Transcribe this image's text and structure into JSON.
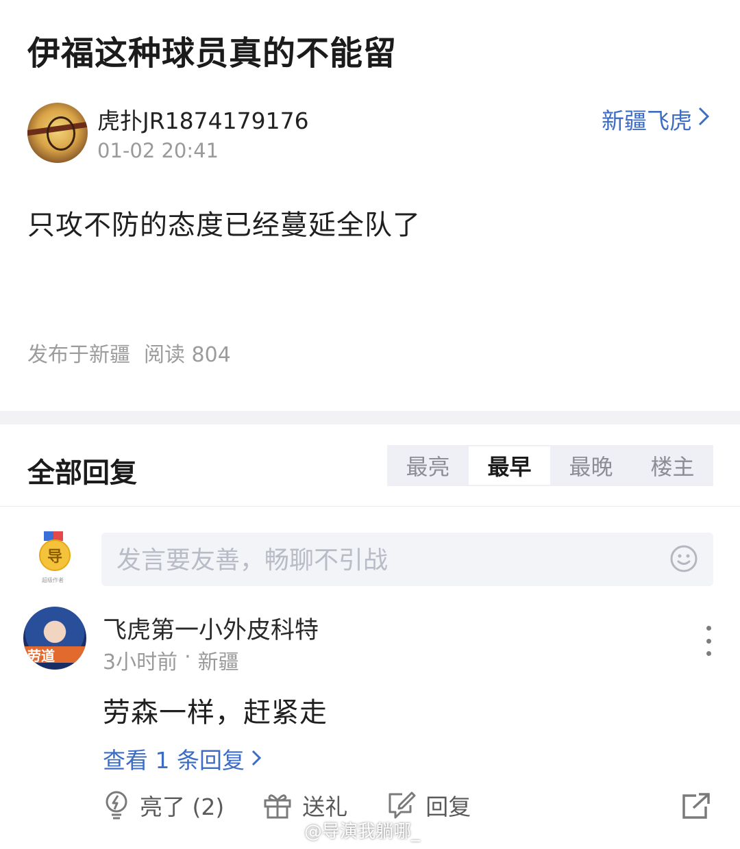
{
  "post": {
    "title": "伊福这种球员真的不能留",
    "author": "虎扑JR1874179176",
    "time": "01-02 20:41",
    "board": "新疆飞虎",
    "body": "只攻不防的态度已经蔓延全队了",
    "published_in": "发布于新疆",
    "read_count": "阅读 804"
  },
  "replies": {
    "title": "全部回复",
    "sort_tabs": [
      "最亮",
      "最早",
      "最晚",
      "楼主"
    ],
    "active_tab": "最早",
    "input_placeholder": "发言要友善，畅聊不引战",
    "badge_glyph": "导",
    "badge_caption": "超级作者"
  },
  "comment": {
    "author": "飞虎第一小外皮科特",
    "time": "3小时前",
    "separator": "·",
    "location": "新疆",
    "avatar_text": "劳道",
    "text": "劳森一样，赶紧走",
    "view_replies": "查看 1 条回复",
    "actions": {
      "like": "亮了 (2)",
      "gift": "送礼",
      "reply": "回复"
    }
  },
  "watermark": "@导演我躺哪_"
}
